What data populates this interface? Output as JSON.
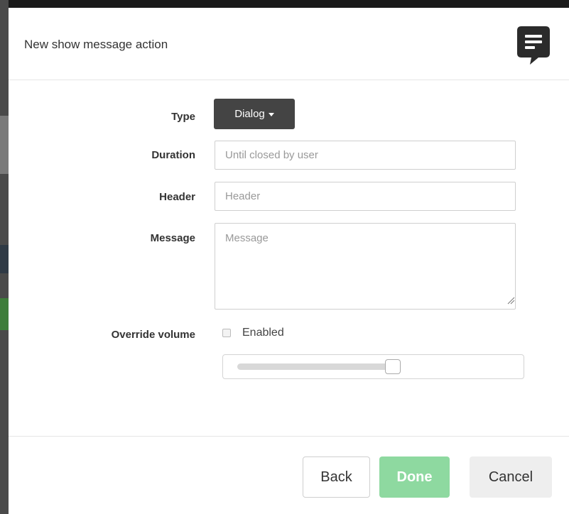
{
  "dialog": {
    "title": "New show message action",
    "header_icon": "message-icon"
  },
  "form": {
    "type": {
      "label": "Type",
      "value": "Dialog"
    },
    "duration": {
      "label": "Duration",
      "placeholder": "Until closed by user",
      "value": ""
    },
    "header": {
      "label": "Header",
      "placeholder": "Header",
      "value": ""
    },
    "message": {
      "label": "Message",
      "placeholder": "Message",
      "value": ""
    },
    "override_volume": {
      "label": "Override volume",
      "checkbox_label": "Enabled",
      "checked": false,
      "volume_fraction": 0.96
    }
  },
  "footer": {
    "back_label": "Back",
    "done_label": "Done",
    "cancel_label": "Cancel"
  },
  "colors": {
    "accent_done": "#8ed9a0",
    "dropdown_bg": "#444444"
  }
}
